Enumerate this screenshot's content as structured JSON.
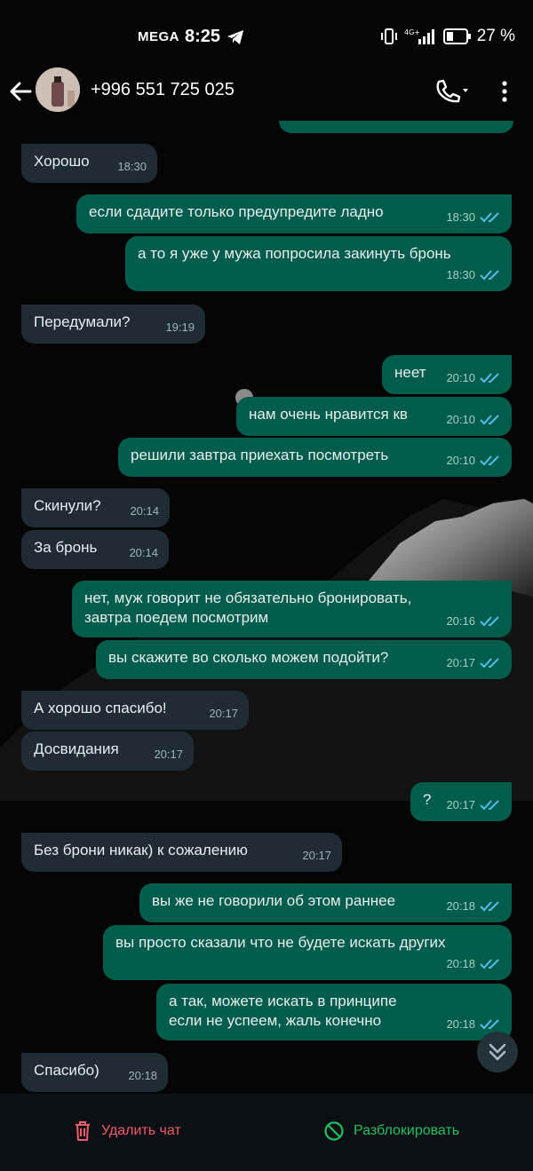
{
  "status_bar": {
    "carrier": "MEGA",
    "time": "8:25",
    "network": "4G+",
    "battery": "27 %"
  },
  "header": {
    "contact": "+996 551 725 025"
  },
  "messages": [
    {
      "text": "Хорошо",
      "time": "18:30"
    },
    {
      "text": "если сдадите только предупредите ладно",
      "time": "18:30"
    },
    {
      "text": "а то я уже у мужа попросила закинуть бронь",
      "time": "18:30"
    },
    {
      "text": "Передумали?",
      "time": "19:19"
    },
    {
      "text": "неет",
      "time": "20:10"
    },
    {
      "text": "нам очень нравится кв",
      "time": "20:10"
    },
    {
      "text": "решили завтра приехать посмотреть",
      "time": "20:10"
    },
    {
      "text": "Скинули?",
      "time": "20:14"
    },
    {
      "text": "За бронь",
      "time": "20:14"
    },
    {
      "line1": "нет, муж говорит не обязательно бронировать,",
      "line2": "завтра поедем посмотрим",
      "time": "20:16"
    },
    {
      "text": "вы скажите во сколько можем подойти?",
      "time": "20:17"
    },
    {
      "text": "А хорошо спасибо!",
      "time": "20:17"
    },
    {
      "text": "Досвидания",
      "time": "20:17"
    },
    {
      "text": "?",
      "time": "20:17"
    },
    {
      "text": "Без брони никак) к сожалению",
      "time": "20:17"
    },
    {
      "text": "вы же не говорили об этом раннее",
      "time": "20:18"
    },
    {
      "text": "вы просто сказали что не будете искать других",
      "time": "20:18"
    },
    {
      "line1": "а так, можете искать в принципе",
      "line2": "если не успеем, жаль конечно",
      "time": "20:18"
    },
    {
      "text": "Спасибо)",
      "time": "20:18"
    }
  ],
  "bottom_bar": {
    "delete_label": "Удалить чат",
    "unblock_label": "Разблокировать"
  },
  "colors": {
    "incoming": "#1f2c34",
    "outgoing": "#005c4b",
    "read_tick": "#53bdeb",
    "delete": "#f15c6d",
    "unblock": "#21c063"
  }
}
